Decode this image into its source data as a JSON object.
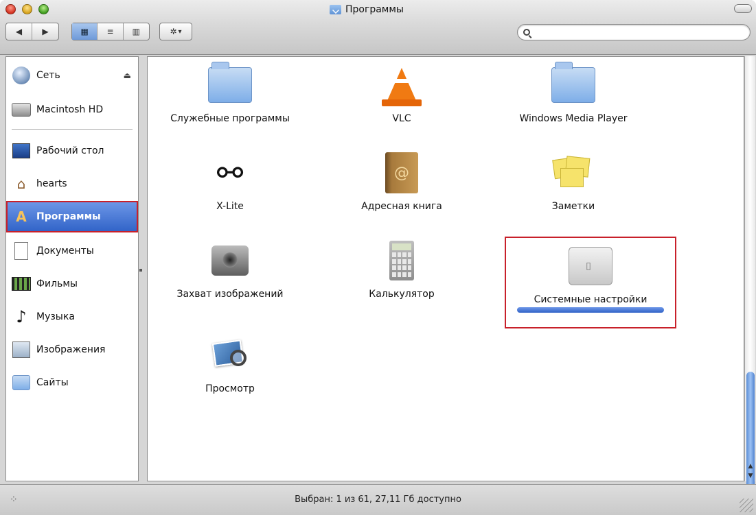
{
  "window": {
    "title": "Программы"
  },
  "toolbar": {
    "back_glyph": "◀",
    "forward_glyph": "▶",
    "view_icons_glyph": "▦",
    "view_list_glyph": "≡",
    "view_columns_glyph": "▥",
    "action_glyph": "✲",
    "action_caret": "▾",
    "search_placeholder": ""
  },
  "sidebar": {
    "items": [
      {
        "label": "Сеть",
        "icon": "globe-icon"
      },
      {
        "label": "Macintosh HD",
        "icon": "hard-drive-icon"
      },
      {
        "label": "Рабочий стол",
        "icon": "desktop-icon"
      },
      {
        "label": "hearts",
        "icon": "home-icon"
      },
      {
        "label": "Программы",
        "icon": "applications-icon"
      },
      {
        "label": "Документы",
        "icon": "document-icon"
      },
      {
        "label": "Фильмы",
        "icon": "film-icon"
      },
      {
        "label": "Музыка",
        "icon": "music-icon"
      },
      {
        "label": "Изображения",
        "icon": "picture-icon"
      },
      {
        "label": "Сайты",
        "icon": "sites-folder-icon"
      }
    ],
    "eject_glyph": "⏏"
  },
  "apps": [
    {
      "label": "Служебные программы",
      "icon": "utilities-folder-icon"
    },
    {
      "label": "VLC",
      "icon": "vlc-cone-icon"
    },
    {
      "label": "Windows Media Player",
      "icon": "folder-icon"
    },
    {
      "label": "X-Lite",
      "icon": "xlite-icon"
    },
    {
      "label": "Адресная книга",
      "icon": "address-book-icon"
    },
    {
      "label": "Заметки",
      "icon": "stickies-icon"
    },
    {
      "label": "Захват изображений",
      "icon": "image-capture-icon"
    },
    {
      "label": "Калькулятор",
      "icon": "calculator-icon"
    },
    {
      "label": "Системные настройки",
      "icon": "system-preferences-icon"
    },
    {
      "label": "Просмотр",
      "icon": "preview-icon"
    }
  ],
  "status": {
    "text": "Выбран: 1 из 61, 27,11 Гб доступно"
  },
  "colors": {
    "selection": "#2f62c7",
    "highlight_frame": "#c8202a"
  }
}
